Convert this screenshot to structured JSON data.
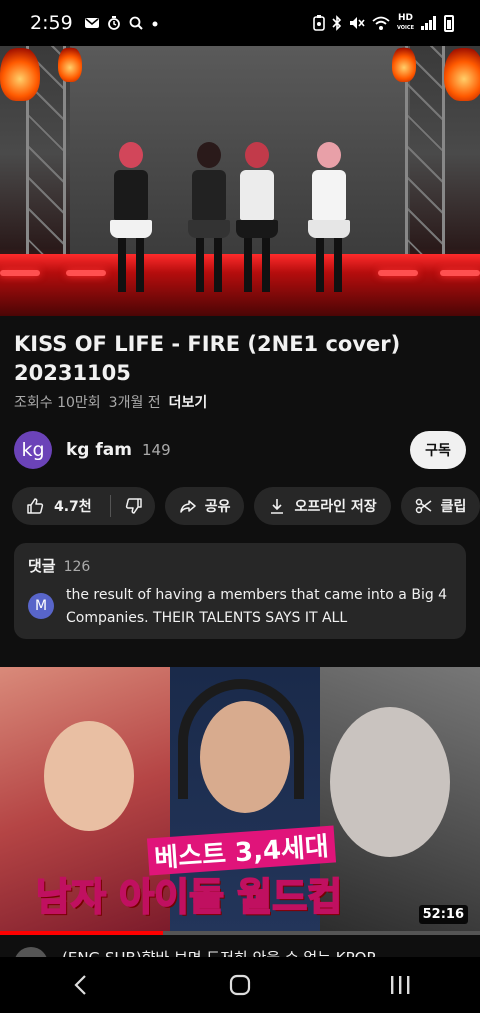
{
  "status_bar": {
    "time": "2:59",
    "network_badge_top": "HD",
    "network_badge_bottom": "VOICE"
  },
  "video": {
    "title": "KISS OF LIFE - FIRE (2NE1 cover) 20231105",
    "views": "조회수 10만회",
    "age": "3개월 전",
    "more": "더보기"
  },
  "channel": {
    "avatar_text": "kg",
    "name": "kg fam",
    "subscribers": "149",
    "subscribe_label": "구독",
    "avatar_color": "#6b43b8"
  },
  "actions": {
    "like_count": "4.7천",
    "share_label": "공유",
    "download_label": "오프라인 저장",
    "clip_label": "클립"
  },
  "comments": {
    "title": "댓글",
    "count": "126",
    "top_comment_avatar": "M",
    "top_comment_text": "the result of having a members that came into a Big 4 Companies. THEIR TALENTS SAYS IT ALL"
  },
  "next_video": {
    "caption_line1": "베스트 3,4세대",
    "caption_line2": "남자 아이돌 월드컵",
    "duration": "52:16",
    "watch_progress": 0.34,
    "title": "(ENG SUB)향바 보면 도저히 안을 수 없는 KPOP ..."
  },
  "icons": {
    "status_left": [
      "mail-icon",
      "alarm-icon",
      "search-icon",
      "dot-icon"
    ],
    "status_right": [
      "nfc-icon",
      "bluetooth-icon",
      "mute-icon",
      "wifi-icon",
      "signal-icon",
      "battery-icon"
    ],
    "nav": [
      "back-icon",
      "home-icon",
      "recents-icon"
    ]
  },
  "colors": {
    "background": "#0f0f0f",
    "pill": "#272727",
    "accent": "#ff0000"
  }
}
